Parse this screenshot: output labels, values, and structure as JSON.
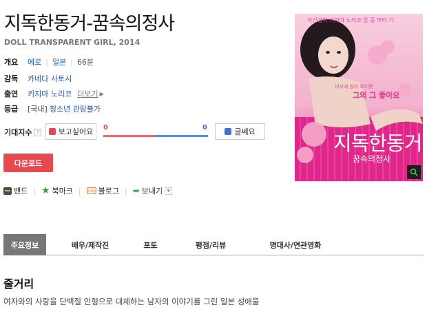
{
  "movie": {
    "title": "지독한동거-꿈속의정사",
    "subtitle": "DOLL TRANSPARENT GIRL, 2014"
  },
  "info": {
    "overview_label": "개요",
    "genre": "에로",
    "country": "일본",
    "runtime": "66분",
    "director_label": "감독",
    "director": "카네다 사토시",
    "cast_label": "출연",
    "cast": "키지마 노리코",
    "more_label": "더보기",
    "rating_label": "등급",
    "rating_region": "[국내]",
    "rating": "청소년 관람불가"
  },
  "expect": {
    "label": "기대지수",
    "help_icon": "question-icon",
    "want_label": "보고싶어요",
    "want_count": "0",
    "no_label": "글쎄요",
    "no_count": "0",
    "want_share": 0.5,
    "colors": {
      "want": "#e34950",
      "no": "#3d74c9"
    }
  },
  "download": {
    "label": "다운로드",
    "color": "#e8494f"
  },
  "share": {
    "band": "밴드",
    "bookmark": "북마크",
    "blog": "블로그",
    "blog_icon_text": "blog",
    "send": "보내기"
  },
  "poster": {
    "top_text": "어신경의 키처마 노리코 앞 중 부터 기",
    "speech_line1": "피부에 앉아 모이듯",
    "speech_line2": "그의 그 좋아요",
    "title_art": "지독한동거",
    "subtitle_art": "꿈속의정사"
  },
  "tabs": [
    {
      "label": "주요정보"
    },
    {
      "label": "배우/제작진"
    },
    {
      "label": "포토"
    },
    {
      "label": "평점/리뷰"
    },
    {
      "label": "명대사/연관영화"
    }
  ],
  "plot": {
    "heading": "줄거리",
    "text": "여자와의 사랑을 단백질 인형으로 대체하는 남자의 이야기를 그린 일본 성애물"
  }
}
